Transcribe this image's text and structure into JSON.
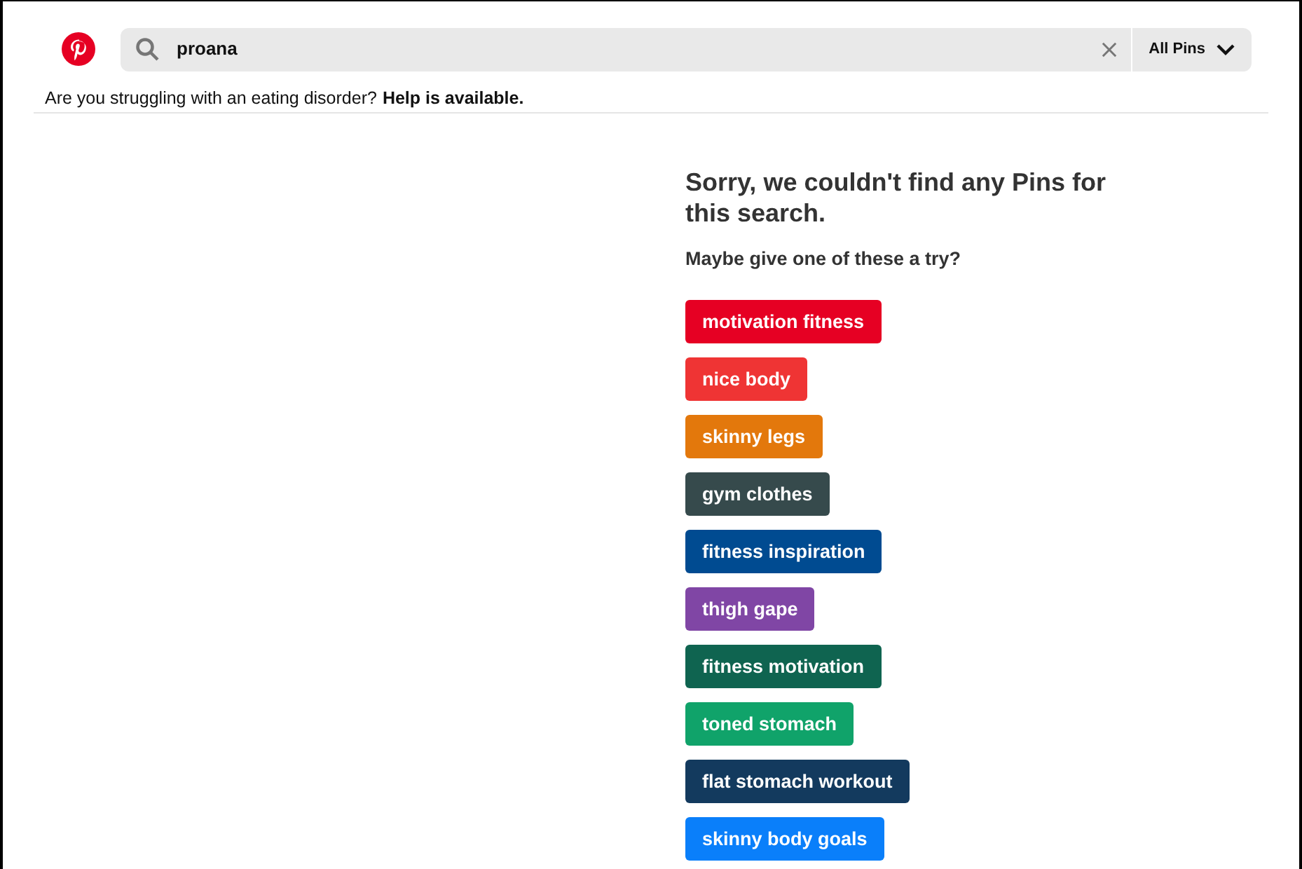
{
  "search": {
    "value": "proana",
    "scope": "All Pins"
  },
  "notice": {
    "text": "Are you struggling with an eating disorder?",
    "link": "Help is available."
  },
  "results": {
    "title": "Sorry, we couldn't find any Pins for this search.",
    "subtitle": "Maybe give one of these a try?",
    "suggestions": [
      {
        "label": "motivation fitness",
        "color": "#e60023"
      },
      {
        "label": "nice body",
        "color": "#ef3434"
      },
      {
        "label": "skinny legs",
        "color": "#e3780c"
      },
      {
        "label": "gym clothes",
        "color": "#364a4c"
      },
      {
        "label": "fitness inspiration",
        "color": "#004b91"
      },
      {
        "label": "thigh gape",
        "color": "#8046a5"
      },
      {
        "label": "fitness motivation",
        "color": "#0f6450"
      },
      {
        "label": "toned stomach",
        "color": "#10a36a"
      },
      {
        "label": "flat stomach workout",
        "color": "#133a5e"
      },
      {
        "label": "skinny body goals",
        "color": "#0a7ffa"
      }
    ]
  }
}
